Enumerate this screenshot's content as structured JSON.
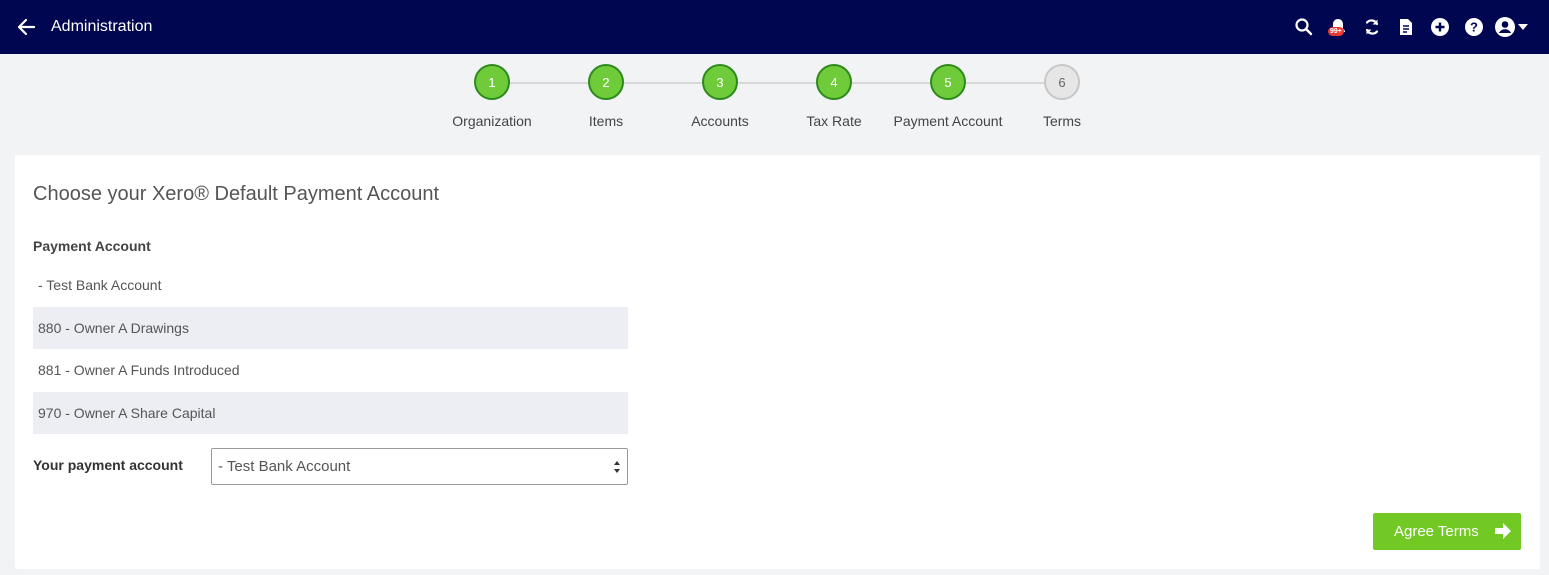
{
  "header": {
    "title": "Administration",
    "notification_badge": "99+"
  },
  "steps": [
    {
      "number": "1",
      "label": "Organization",
      "state": "done"
    },
    {
      "number": "2",
      "label": "Items",
      "state": "done"
    },
    {
      "number": "3",
      "label": "Accounts",
      "state": "done"
    },
    {
      "number": "4",
      "label": "Tax Rate",
      "state": "done"
    },
    {
      "number": "5",
      "label": "Payment Account",
      "state": "done"
    },
    {
      "number": "6",
      "label": "Terms",
      "state": "todo"
    }
  ],
  "main": {
    "title": "Choose your Xero® Default Payment Account",
    "section_label": "Payment Account",
    "accounts": [
      " - Test Bank Account",
      "880 - Owner A Drawings",
      "881 - Owner A Funds Introduced",
      "970 - Owner A Share Capital"
    ],
    "field_label": "Your payment account",
    "selected_account": "- Test Bank Account",
    "agree_label": "Agree Terms"
  },
  "colors": {
    "topbar": "#00064f",
    "step_done": "#6fcb39",
    "step_todo": "#e6e6e6",
    "agree_button": "#73c924",
    "row_shade": "#eceef4"
  }
}
